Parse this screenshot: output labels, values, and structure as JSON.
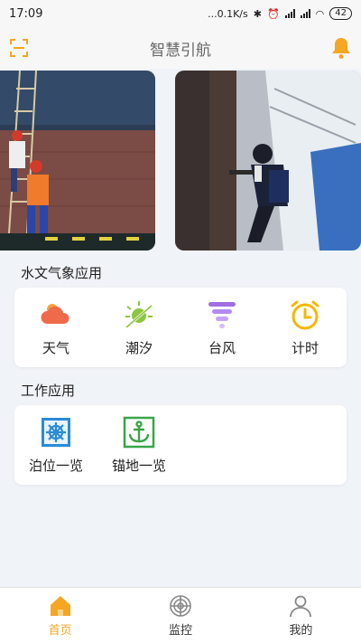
{
  "status_bar": {
    "time": "17:09",
    "network_speed": "...0.1K/s",
    "battery": "42"
  },
  "header": {
    "title": "智慧引航"
  },
  "hydro_section": {
    "title": "水文气象应用",
    "items": [
      {
        "label": "天气",
        "icon": "weather-cloud-icon"
      },
      {
        "label": "潮汐",
        "icon": "tide-icon"
      },
      {
        "label": "台风",
        "icon": "typhoon-icon"
      },
      {
        "label": "计时",
        "icon": "timer-clock-icon"
      }
    ]
  },
  "work_section": {
    "title": "工作应用",
    "items": [
      {
        "label": "泊位一览",
        "icon": "berth-wheel-icon"
      },
      {
        "label": "锚地一览",
        "icon": "anchor-icon"
      }
    ]
  },
  "tabbar": {
    "items": [
      {
        "label": "首页",
        "icon": "home-icon",
        "active": true
      },
      {
        "label": "监控",
        "icon": "radar-icon",
        "active": false
      },
      {
        "label": "我的",
        "icon": "user-icon",
        "active": false
      }
    ]
  },
  "colors": {
    "accent": "#f5a623",
    "page_bg": "#f0f3f7",
    "card_bg": "#ffffff"
  }
}
